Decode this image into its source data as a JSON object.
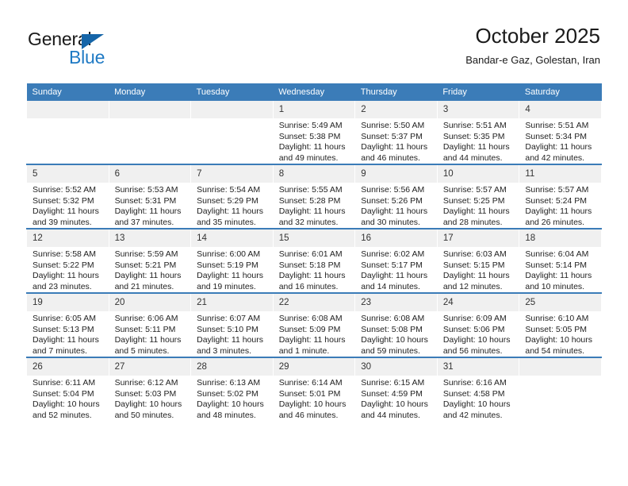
{
  "brand": {
    "name_part1": "General",
    "name_part2": "Blue",
    "triangle_icon": "triangle-icon",
    "color_dark": "#1a1a1a",
    "color_blue": "#1f7ac4"
  },
  "header": {
    "title": "October 2025",
    "subtitle": "Bandar-e Gaz, Golestan, Iran"
  },
  "theme": {
    "header_bg": "#3b7cb8",
    "header_text": "#ffffff",
    "daynum_bg": "#f0f0f0",
    "row_separator": "#3b7cb8"
  },
  "weekdays": [
    "Sunday",
    "Monday",
    "Tuesday",
    "Wednesday",
    "Thursday",
    "Friday",
    "Saturday"
  ],
  "weeks": [
    [
      {
        "empty": true,
        "day": ""
      },
      {
        "empty": true,
        "day": ""
      },
      {
        "empty": true,
        "day": ""
      },
      {
        "empty": false,
        "day": "1",
        "sunrise": "Sunrise: 5:49 AM",
        "sunset": "Sunset: 5:38 PM",
        "daylight": "Daylight: 11 hours and 49 minutes."
      },
      {
        "empty": false,
        "day": "2",
        "sunrise": "Sunrise: 5:50 AM",
        "sunset": "Sunset: 5:37 PM",
        "daylight": "Daylight: 11 hours and 46 minutes."
      },
      {
        "empty": false,
        "day": "3",
        "sunrise": "Sunrise: 5:51 AM",
        "sunset": "Sunset: 5:35 PM",
        "daylight": "Daylight: 11 hours and 44 minutes."
      },
      {
        "empty": false,
        "day": "4",
        "sunrise": "Sunrise: 5:51 AM",
        "sunset": "Sunset: 5:34 PM",
        "daylight": "Daylight: 11 hours and 42 minutes."
      }
    ],
    [
      {
        "empty": false,
        "day": "5",
        "sunrise": "Sunrise: 5:52 AM",
        "sunset": "Sunset: 5:32 PM",
        "daylight": "Daylight: 11 hours and 39 minutes."
      },
      {
        "empty": false,
        "day": "6",
        "sunrise": "Sunrise: 5:53 AM",
        "sunset": "Sunset: 5:31 PM",
        "daylight": "Daylight: 11 hours and 37 minutes."
      },
      {
        "empty": false,
        "day": "7",
        "sunrise": "Sunrise: 5:54 AM",
        "sunset": "Sunset: 5:29 PM",
        "daylight": "Daylight: 11 hours and 35 minutes."
      },
      {
        "empty": false,
        "day": "8",
        "sunrise": "Sunrise: 5:55 AM",
        "sunset": "Sunset: 5:28 PM",
        "daylight": "Daylight: 11 hours and 32 minutes."
      },
      {
        "empty": false,
        "day": "9",
        "sunrise": "Sunrise: 5:56 AM",
        "sunset": "Sunset: 5:26 PM",
        "daylight": "Daylight: 11 hours and 30 minutes."
      },
      {
        "empty": false,
        "day": "10",
        "sunrise": "Sunrise: 5:57 AM",
        "sunset": "Sunset: 5:25 PM",
        "daylight": "Daylight: 11 hours and 28 minutes."
      },
      {
        "empty": false,
        "day": "11",
        "sunrise": "Sunrise: 5:57 AM",
        "sunset": "Sunset: 5:24 PM",
        "daylight": "Daylight: 11 hours and 26 minutes."
      }
    ],
    [
      {
        "empty": false,
        "day": "12",
        "sunrise": "Sunrise: 5:58 AM",
        "sunset": "Sunset: 5:22 PM",
        "daylight": "Daylight: 11 hours and 23 minutes."
      },
      {
        "empty": false,
        "day": "13",
        "sunrise": "Sunrise: 5:59 AM",
        "sunset": "Sunset: 5:21 PM",
        "daylight": "Daylight: 11 hours and 21 minutes."
      },
      {
        "empty": false,
        "day": "14",
        "sunrise": "Sunrise: 6:00 AM",
        "sunset": "Sunset: 5:19 PM",
        "daylight": "Daylight: 11 hours and 19 minutes."
      },
      {
        "empty": false,
        "day": "15",
        "sunrise": "Sunrise: 6:01 AM",
        "sunset": "Sunset: 5:18 PM",
        "daylight": "Daylight: 11 hours and 16 minutes."
      },
      {
        "empty": false,
        "day": "16",
        "sunrise": "Sunrise: 6:02 AM",
        "sunset": "Sunset: 5:17 PM",
        "daylight": "Daylight: 11 hours and 14 minutes."
      },
      {
        "empty": false,
        "day": "17",
        "sunrise": "Sunrise: 6:03 AM",
        "sunset": "Sunset: 5:15 PM",
        "daylight": "Daylight: 11 hours and 12 minutes."
      },
      {
        "empty": false,
        "day": "18",
        "sunrise": "Sunrise: 6:04 AM",
        "sunset": "Sunset: 5:14 PM",
        "daylight": "Daylight: 11 hours and 10 minutes."
      }
    ],
    [
      {
        "empty": false,
        "day": "19",
        "sunrise": "Sunrise: 6:05 AM",
        "sunset": "Sunset: 5:13 PM",
        "daylight": "Daylight: 11 hours and 7 minutes."
      },
      {
        "empty": false,
        "day": "20",
        "sunrise": "Sunrise: 6:06 AM",
        "sunset": "Sunset: 5:11 PM",
        "daylight": "Daylight: 11 hours and 5 minutes."
      },
      {
        "empty": false,
        "day": "21",
        "sunrise": "Sunrise: 6:07 AM",
        "sunset": "Sunset: 5:10 PM",
        "daylight": "Daylight: 11 hours and 3 minutes."
      },
      {
        "empty": false,
        "day": "22",
        "sunrise": "Sunrise: 6:08 AM",
        "sunset": "Sunset: 5:09 PM",
        "daylight": "Daylight: 11 hours and 1 minute."
      },
      {
        "empty": false,
        "day": "23",
        "sunrise": "Sunrise: 6:08 AM",
        "sunset": "Sunset: 5:08 PM",
        "daylight": "Daylight: 10 hours and 59 minutes."
      },
      {
        "empty": false,
        "day": "24",
        "sunrise": "Sunrise: 6:09 AM",
        "sunset": "Sunset: 5:06 PM",
        "daylight": "Daylight: 10 hours and 56 minutes."
      },
      {
        "empty": false,
        "day": "25",
        "sunrise": "Sunrise: 6:10 AM",
        "sunset": "Sunset: 5:05 PM",
        "daylight": "Daylight: 10 hours and 54 minutes."
      }
    ],
    [
      {
        "empty": false,
        "day": "26",
        "sunrise": "Sunrise: 6:11 AM",
        "sunset": "Sunset: 5:04 PM",
        "daylight": "Daylight: 10 hours and 52 minutes."
      },
      {
        "empty": false,
        "day": "27",
        "sunrise": "Sunrise: 6:12 AM",
        "sunset": "Sunset: 5:03 PM",
        "daylight": "Daylight: 10 hours and 50 minutes."
      },
      {
        "empty": false,
        "day": "28",
        "sunrise": "Sunrise: 6:13 AM",
        "sunset": "Sunset: 5:02 PM",
        "daylight": "Daylight: 10 hours and 48 minutes."
      },
      {
        "empty": false,
        "day": "29",
        "sunrise": "Sunrise: 6:14 AM",
        "sunset": "Sunset: 5:01 PM",
        "daylight": "Daylight: 10 hours and 46 minutes."
      },
      {
        "empty": false,
        "day": "30",
        "sunrise": "Sunrise: 6:15 AM",
        "sunset": "Sunset: 4:59 PM",
        "daylight": "Daylight: 10 hours and 44 minutes."
      },
      {
        "empty": false,
        "day": "31",
        "sunrise": "Sunrise: 6:16 AM",
        "sunset": "Sunset: 4:58 PM",
        "daylight": "Daylight: 10 hours and 42 minutes."
      },
      {
        "empty": true,
        "day": ""
      }
    ]
  ]
}
